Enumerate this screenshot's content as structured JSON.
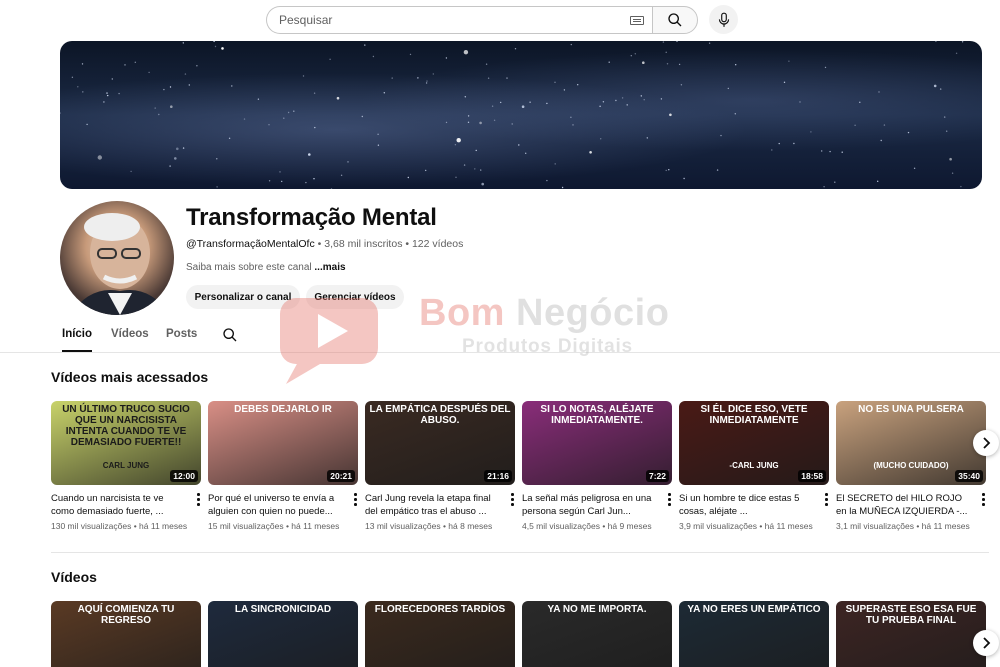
{
  "search": {
    "placeholder": "Pesquisar"
  },
  "channel": {
    "title": "Transformação Mental",
    "handle": "@TransformaçãoMentalOfc",
    "subscribers": "3,68 mil inscritos",
    "videos_count": "122 vídeos",
    "separator": " • ",
    "description": "Saiba mais sobre este canal",
    "more_label": "...mais",
    "customize_button": "Personalizar o canal",
    "manage_button": "Gerenciar vídeos"
  },
  "tabs": [
    {
      "label": "Início",
      "active": true
    },
    {
      "label": "Vídeos",
      "active": false
    },
    {
      "label": "Posts",
      "active": false
    }
  ],
  "sections": {
    "popular_title": "Vídeos mais acessados",
    "videos_title": "Vídeos"
  },
  "popular_videos": [
    {
      "thumb_text": "Un último truco sucio que un narcisista intenta cuando te ve demasiado fuerte!!",
      "thumb_caption": "CARL JUNG",
      "duration": "12:00",
      "title": "Cuando un narcisista te ve como demasiado fuerte, ...",
      "views": "130 mil visualizações",
      "age": "há 11 meses",
      "bg": "#c9d36a",
      "text_color": "#1b1b1b"
    },
    {
      "thumb_text": "DEBES DEJARLO IR",
      "thumb_caption": "",
      "duration": "20:21",
      "title": "Por qué el universo te envía a alguien con quien no puede...",
      "views": "15 mil visualizações",
      "age": "há 11 meses",
      "bg": "#d98f86",
      "text_color": "#ffffff"
    },
    {
      "thumb_text": "La empática después del abuso.",
      "thumb_caption": "",
      "duration": "21:16",
      "title": "Carl Jung revela la etapa final del empático tras el abuso ...",
      "views": "13 mil visualizações",
      "age": "há 8 meses",
      "bg": "#3a2a22",
      "text_color": "#ffffff"
    },
    {
      "thumb_text": "Si lo notas, aléjate inmediatamente.",
      "thumb_caption": "",
      "duration": "7:22",
      "title": "La señal más peligrosa en una persona según Carl Jun...",
      "views": "4,5 mil visualizações",
      "age": "há 9 meses",
      "bg": "#8a2d7a",
      "text_color": "#ffffff"
    },
    {
      "thumb_text": "Si él dice eso, vete inmediatamente",
      "thumb_caption": "-CARL JUNG",
      "duration": "18:58",
      "title": "Si un hombre te dice estas 5 cosas, aléjate ...",
      "views": "3,9 mil visualizações",
      "age": "há 11 meses",
      "bg": "#4a1a16",
      "text_color": "#ffffff"
    },
    {
      "thumb_text": "No es una pulsera",
      "thumb_caption": "(mucho cuidado)",
      "duration": "35:40",
      "title": "El SECRETO del HILO ROJO en la MUÑECA IZQUIERDA -...",
      "views": "3,1 mil visualizações",
      "age": "há 11 meses",
      "bg": "#c9a27e",
      "text_color": "#ffffff"
    }
  ],
  "videos": [
    {
      "thumb_text": "Aquí comienza tu regreso",
      "bg": "#5a3a24",
      "text_color": "#ffffff"
    },
    {
      "thumb_text": "La sincronicidad",
      "bg": "#1e2a3d",
      "text_color": "#ffffff"
    },
    {
      "thumb_text": "Florecedores tardíos",
      "bg": "#3b2a1e",
      "text_color": "#ffffff"
    },
    {
      "thumb_text": "Ya no me importa.",
      "bg": "#2a2a2a",
      "text_color": "#ffffff"
    },
    {
      "thumb_text": "Ya no eres un empático",
      "bg": "#1d2a35",
      "text_color": "#ffffff"
    },
    {
      "thumb_text": "Superaste eso Esa fue tu prueba final",
      "bg": "#3d2523",
      "text_color": "#ffffff"
    }
  ],
  "watermark": {
    "brand_part1": "Bom ",
    "brand_part2": "Negócio",
    "subtitle": "Produtos Digitais"
  },
  "icons": {
    "search": "search-icon",
    "keyboard": "keyboard-icon",
    "mic": "mic-icon",
    "next": "chevron-right-icon",
    "more": "more-vert-icon"
  }
}
